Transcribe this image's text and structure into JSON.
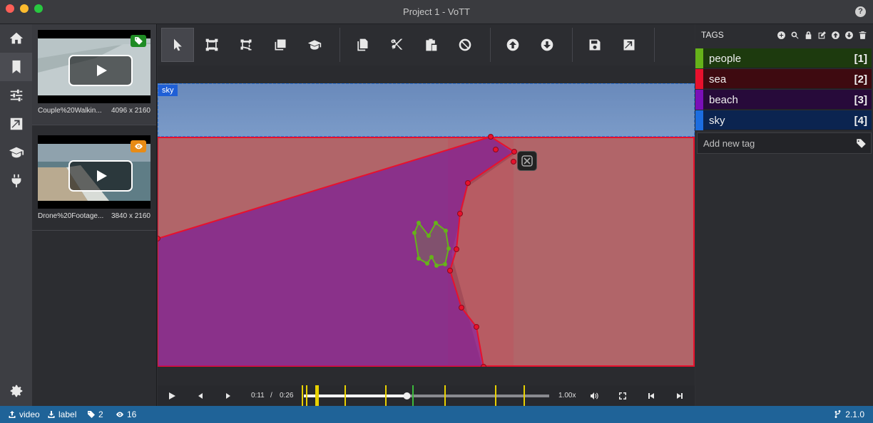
{
  "window": {
    "title": "Project 1 - VoTT"
  },
  "nav": [
    {
      "icon": "home-icon"
    },
    {
      "icon": "bookmark-icon"
    },
    {
      "icon": "sliders-icon"
    },
    {
      "icon": "external-link-icon"
    },
    {
      "icon": "graduation-cap-icon"
    },
    {
      "icon": "plug-icon"
    },
    {
      "icon": "gear-icon"
    }
  ],
  "assets": [
    {
      "name": "Couple%20Walkin...",
      "size": "4096 x 2160",
      "badge": "tag-icon",
      "badge_color": "#1f8b24"
    },
    {
      "name": "Drone%20Footage...",
      "size": "3840 x 2160",
      "badge": "eye-icon",
      "badge_color": "#e88b15"
    }
  ],
  "toolbar": {
    "tools": [
      "pointer-icon",
      "rectangle-icon",
      "polygon-icon",
      "copy-rectangle-icon",
      "active-learning-icon",
      "copy-regions-icon",
      "cut-regions-icon",
      "paste-regions-icon",
      "clear-regions-icon",
      "previous-asset-icon",
      "next-asset-icon",
      "save-icon",
      "export-icon"
    ]
  },
  "canvas": {
    "region_label": "sky"
  },
  "player": {
    "current_time": "0:11",
    "separator": "/",
    "duration": "0:26",
    "speed": "1.00x",
    "progress": 0.42
  },
  "tags": {
    "title": "TAGS",
    "items": [
      {
        "name": "people",
        "key": "[1]",
        "color": "#66b21a",
        "bg": "#1d3a0e"
      },
      {
        "name": "sea",
        "key": "[2]",
        "color": "#e8112d",
        "bg": "#3e0a10"
      },
      {
        "name": "beach",
        "key": "[3]",
        "color": "#7a0fb8",
        "bg": "#270a3a"
      },
      {
        "name": "sky",
        "key": "[4]",
        "color": "#1c6de0",
        "bg": "#0b2450"
      }
    ],
    "add_placeholder": "Add new tag"
  },
  "status": {
    "video": "video",
    "label": "label",
    "tag_count": "2",
    "visited_count": "16",
    "version": "2.1.0"
  },
  "colors": {
    "accent": "#1f6398",
    "sky_region": "#1c6de0",
    "sea_region": "#e8112d",
    "beach_region": "#7a0fb8",
    "people_region": "#66b21a"
  }
}
